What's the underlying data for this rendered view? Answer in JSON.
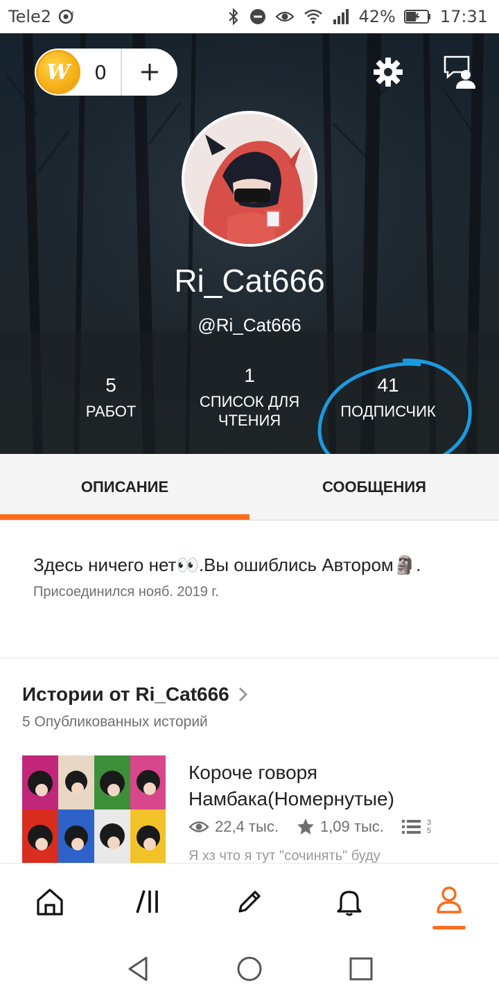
{
  "status_bar": {
    "carrier": "Tele2",
    "battery": "42%",
    "time": "17:31",
    "icons": [
      "cast-icon",
      "bluetooth-icon",
      "dnd-icon",
      "eye-icon",
      "wifi-icon",
      "signal-icon",
      "battery-icon"
    ]
  },
  "header": {
    "coins": "0",
    "coin_logo": "W",
    "display_name": "Ri_Cat666",
    "username": "@Ri_Cat666",
    "stats": [
      {
        "value": "5",
        "label": "РАБОТ"
      },
      {
        "value": "1",
        "label": "СПИСОК ДЛЯ ЧТЕНИЯ"
      },
      {
        "value": "41",
        "label": "ПОДПИСЧИК"
      }
    ],
    "annotation_color": "#1a9be0"
  },
  "tabs": [
    {
      "label": "ОПИСАНИЕ",
      "active": true
    },
    {
      "label": "СООБЩЕНИЯ",
      "active": false
    }
  ],
  "about": {
    "text": "Здесь ничего нет👀.Вы ошиблись Автором🗿.",
    "joined": "Присоединился нояб. 2019 г."
  },
  "stories": {
    "title": "Истории от Ri_Cat666",
    "subtitle": "5 Опубликованных историй",
    "items": [
      {
        "title": "Короче говоря Намбака(Номернутые)",
        "views": "22,4 тыс.",
        "votes": "1,09 тыс.",
        "parts": "3 5",
        "description": "Я хз что я тут \"сочинять\" буду"
      }
    ]
  },
  "bottom_nav": [
    "home-icon",
    "library-icon",
    "write-icon",
    "notifications-icon",
    "profile-icon"
  ],
  "accent_color": "#ff6a1a"
}
